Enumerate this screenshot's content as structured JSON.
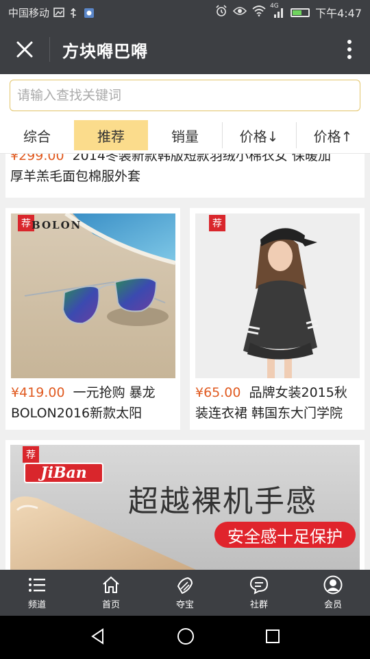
{
  "status_bar": {
    "carrier": "中国移动",
    "time": "下午4:47",
    "network": "4G",
    "battery_level": 0.6
  },
  "app_bar": {
    "title": "方块嘚巴嘚"
  },
  "search": {
    "placeholder": "请输入查找关键词",
    "value": ""
  },
  "sort_tabs": [
    {
      "label": "综合",
      "active": false
    },
    {
      "label": "推荐",
      "active": true
    },
    {
      "label": "销量",
      "active": false
    },
    {
      "label": "价格↓",
      "active": false
    },
    {
      "label": "价格↑",
      "active": false
    }
  ],
  "products": [
    {
      "price": "¥299.00",
      "title_line1": "2014冬装新款韩版短款羽绒小棉衣女 保暖加",
      "title_line2": "厚羊羔毛面包棉服外套"
    },
    {
      "price": "¥419.00",
      "title_line1": "一元抢购 暴龙",
      "title_line2": "BOLON2016新款太阳",
      "image_brand": "BOLON",
      "tag": "荐"
    },
    {
      "price": "¥65.00",
      "title_line1": "品牌女装2015秋",
      "title_line2": "装连衣裙 韩国东大门学院",
      "tag": "荐"
    },
    {
      "tag": "荐",
      "banner_brand": "JiBan",
      "banner_headline": "超越裸机手感",
      "banner_sub": "安全感十足保护"
    }
  ],
  "bottom_nav": [
    {
      "label": "频道",
      "icon": "list-icon"
    },
    {
      "label": "首页",
      "icon": "home-icon"
    },
    {
      "label": "夺宝",
      "icon": "treasure-icon"
    },
    {
      "label": "社群",
      "icon": "chat-icon"
    },
    {
      "label": "会员",
      "icon": "user-icon"
    }
  ],
  "colors": {
    "accent": "#fbdc8c",
    "price": "#e05a20",
    "bar": "#3d3f43",
    "tag": "#d9262c"
  }
}
